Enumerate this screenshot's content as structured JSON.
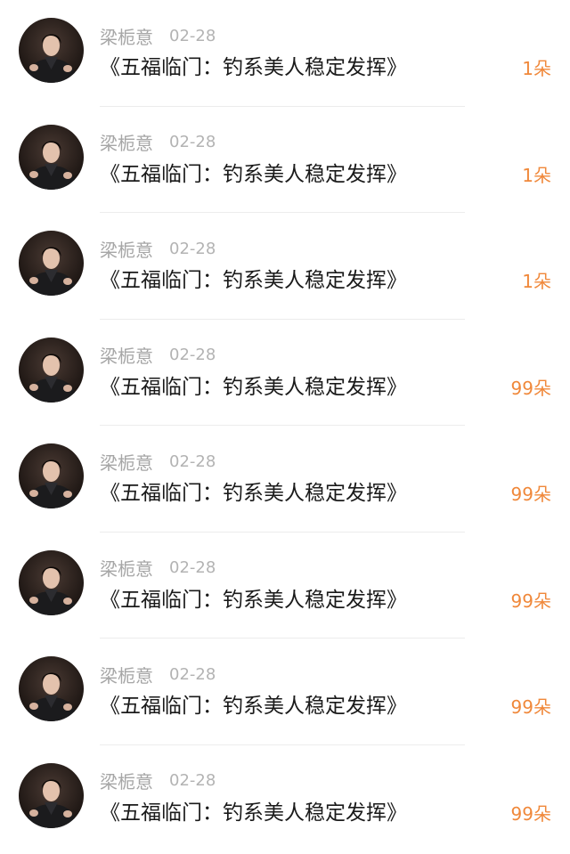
{
  "items": [
    {
      "author": "梁栀意",
      "date": "02-28",
      "message": "《五福临门：钓系美人稳定发挥》",
      "gift": "1朵"
    },
    {
      "author": "梁栀意",
      "date": "02-28",
      "message": "《五福临门：钓系美人稳定发挥》",
      "gift": "1朵"
    },
    {
      "author": "梁栀意",
      "date": "02-28",
      "message": "《五福临门：钓系美人稳定发挥》",
      "gift": "1朵"
    },
    {
      "author": "梁栀意",
      "date": "02-28",
      "message": "《五福临门：钓系美人稳定发挥》",
      "gift": "99朵"
    },
    {
      "author": "梁栀意",
      "date": "02-28",
      "message": "《五福临门：钓系美人稳定发挥》",
      "gift": "99朵"
    },
    {
      "author": "梁栀意",
      "date": "02-28",
      "message": "《五福临门：钓系美人稳定发挥》",
      "gift": "99朵"
    },
    {
      "author": "梁栀意",
      "date": "02-28",
      "message": "《五福临门：钓系美人稳定发挥》",
      "gift": "99朵"
    },
    {
      "author": "梁栀意",
      "date": "02-28",
      "message": "《五福临门：钓系美人稳定发挥》",
      "gift": "99朵"
    }
  ],
  "colors": {
    "author": "#a6a6a6",
    "date": "#b3b3b3",
    "message": "#1a1a1a",
    "gift": "#f0883a",
    "divider": "#ececec"
  }
}
